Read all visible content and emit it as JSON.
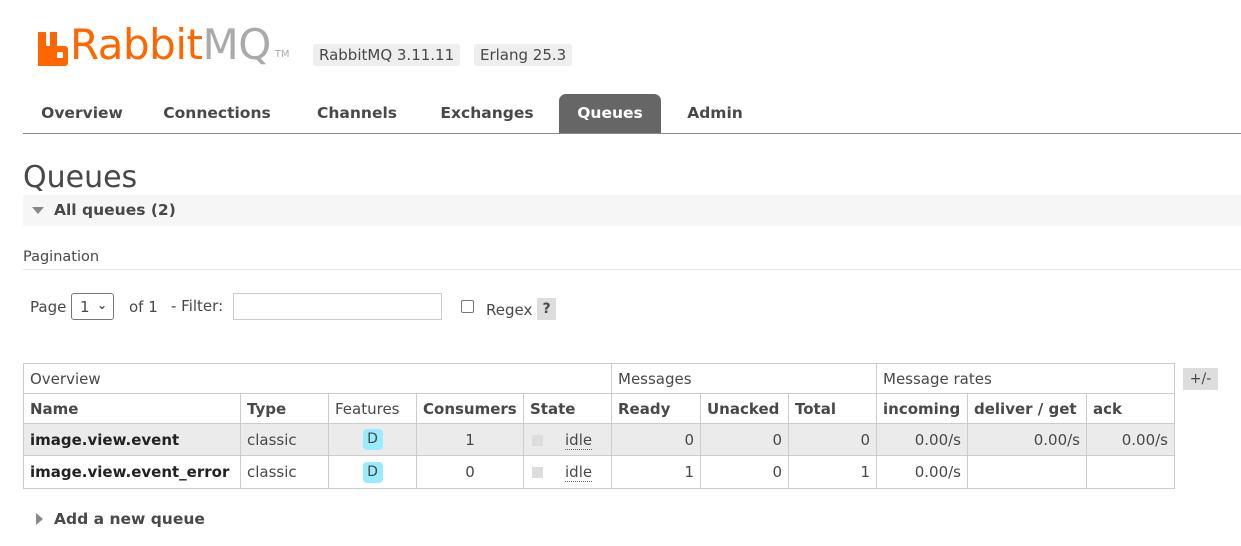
{
  "header": {
    "logo_rabbit": "Rabbit",
    "logo_mq": "MQ",
    "logo_tm": "TM",
    "version_badge": "RabbitMQ 3.11.11",
    "erlang_badge": "Erlang 25.3",
    "brand_color": "#ff6600"
  },
  "tabs": [
    {
      "label": "Overview"
    },
    {
      "label": "Connections"
    },
    {
      "label": "Channels"
    },
    {
      "label": "Exchanges"
    },
    {
      "label": "Queues",
      "active": true
    },
    {
      "label": "Admin"
    }
  ],
  "page_title": "Queues",
  "section": {
    "title": "All queues (2)",
    "expanded": true
  },
  "pagination": {
    "label": "Pagination",
    "page_label": "Page",
    "page_value": "1",
    "of_label": "of 1",
    "filter_label": "- Filter:",
    "filter_value": "",
    "regex_label": "Regex",
    "regex_checked": false,
    "help_label": "?"
  },
  "table": {
    "group_headers": [
      "Overview",
      "Messages",
      "Message rates"
    ],
    "columns": [
      "Name",
      "Type",
      "Features",
      "Consumers",
      "State",
      "Ready",
      "Unacked",
      "Total",
      "incoming",
      "deliver / get",
      "ack"
    ],
    "toggle_columns_label": "+/-",
    "rows": [
      {
        "name": "image.view.event",
        "type": "classic",
        "features": "D",
        "consumers": "1",
        "state": "idle",
        "ready": "0",
        "unacked": "0",
        "total": "0",
        "incoming": "0.00/s",
        "deliver_get": "0.00/s",
        "ack": "0.00/s"
      },
      {
        "name": "image.view.event_error",
        "type": "classic",
        "features": "D",
        "consumers": "0",
        "state": "idle",
        "ready": "1",
        "unacked": "0",
        "total": "1",
        "incoming": "0.00/s",
        "deliver_get": "",
        "ack": ""
      }
    ]
  },
  "add_queue_label": "Add a new queue"
}
